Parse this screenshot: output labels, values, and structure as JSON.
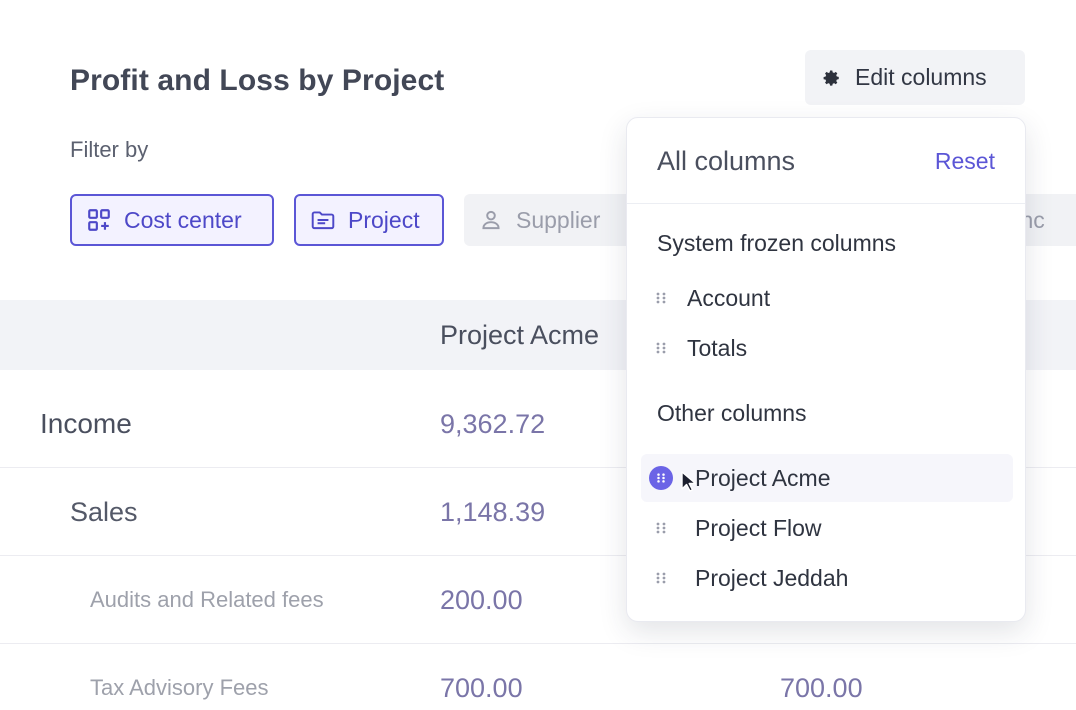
{
  "header": {
    "title": "Profit and Loss by Project",
    "edit_columns_label": "Edit columns"
  },
  "filters": {
    "label": "Filter by",
    "chips": [
      {
        "label": "Cost center",
        "icon": "grid-add-icon",
        "active": true
      },
      {
        "label": "Project",
        "icon": "folder-icon",
        "active": true
      },
      {
        "label": "Supplier",
        "icon": "user-icon",
        "active": false
      },
      {
        "label": "ranc",
        "icon": "",
        "active": false
      }
    ]
  },
  "table": {
    "column_headers": [
      "Project Acme"
    ],
    "rows": [
      {
        "name": "Income",
        "values": [
          "9,362.72"
        ]
      },
      {
        "name": "Sales",
        "values": [
          "1,148.39"
        ]
      },
      {
        "name": "Audits and Related fees",
        "values": [
          "200.00"
        ]
      },
      {
        "name": "Tax Advisory Fees",
        "values": [
          "700.00",
          "700.00"
        ]
      }
    ]
  },
  "dropdown": {
    "title": "All columns",
    "reset_label": "Reset",
    "frozen_section": "System frozen columns",
    "frozen_items": [
      "Account",
      "Totals"
    ],
    "other_section": "Other columns",
    "other_items": [
      "Project Acme",
      "Project Flow",
      "Project Jeddah"
    ]
  },
  "colors": {
    "accent": "#5b56d6",
    "accent_bg": "#f3f2ff",
    "value_text": "#7a75a8",
    "header_bg": "#f2f3f7"
  }
}
